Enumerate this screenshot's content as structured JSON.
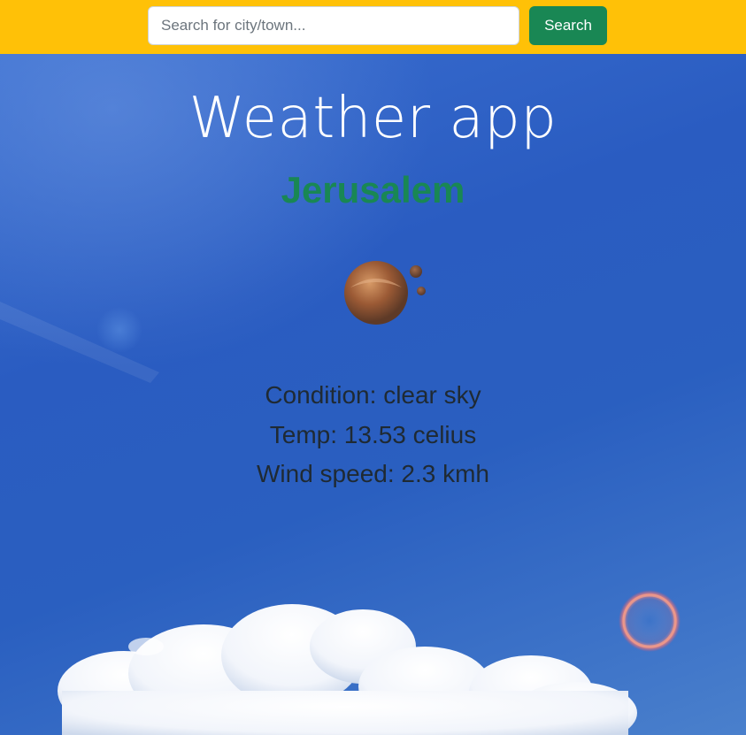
{
  "header": {
    "search_placeholder": "Search for city/town...",
    "search_button_label": "Search",
    "background_color": "#ffc107",
    "button_color": "#198754"
  },
  "main": {
    "title": "Weather app",
    "city": "Jerusalem",
    "city_color": "#198754",
    "weather_icon": "clear-sky-icon",
    "condition_text": "Condition: clear sky",
    "temp_text": "Temp: 13.53 celius",
    "wind_text": "Wind speed: 2.3 kmh"
  }
}
